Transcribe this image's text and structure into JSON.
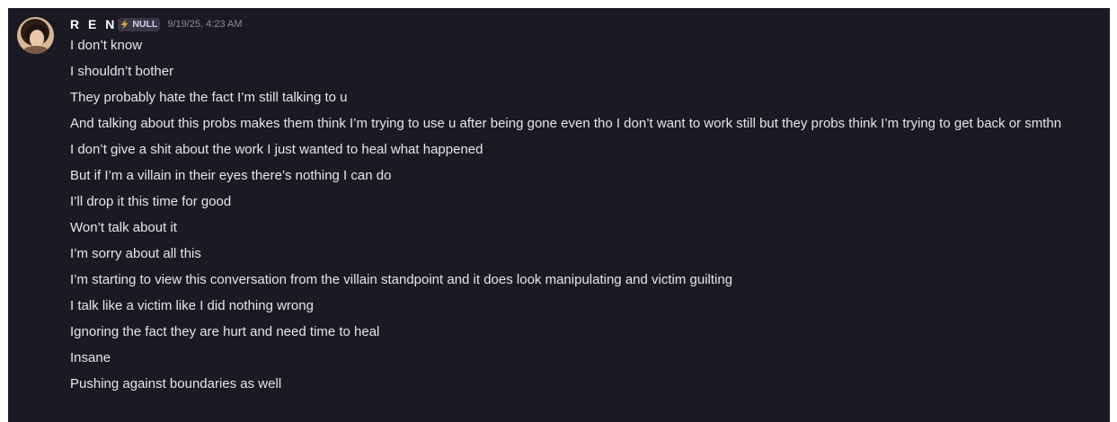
{
  "message": {
    "author": {
      "username": "R E N",
      "tag_label": "NULL",
      "tag_icon": "lightning-icon",
      "tag_color": "#e6a93a",
      "avatar": "user-avatar"
    },
    "timestamp": "9/19/25, 4:23 AM",
    "lines": [
      "I don’t know",
      "I shouldn’t bother",
      "They probably hate the fact I’m still talking to u",
      "And talking about this probs makes them think I’m trying to use u after being gone even tho I don’t want to work still but they probs think I’m trying to get back or smthn",
      "I don’t give a shit about the work I just wanted to heal what happened",
      "But if I’m a villain in their eyes there’s nothing I can do",
      "I’ll drop it this time for good",
      "Won’t talk about it",
      "I’m sorry about all this",
      "I’m starting to view this conversation from the villain standpoint and it does look manipulating and victim guilting",
      "I talk like a victim like I did nothing wrong",
      "Ignoring the fact they are hurt and need time to heal",
      "Insane",
      "Pushing against boundaries as well"
    ]
  }
}
